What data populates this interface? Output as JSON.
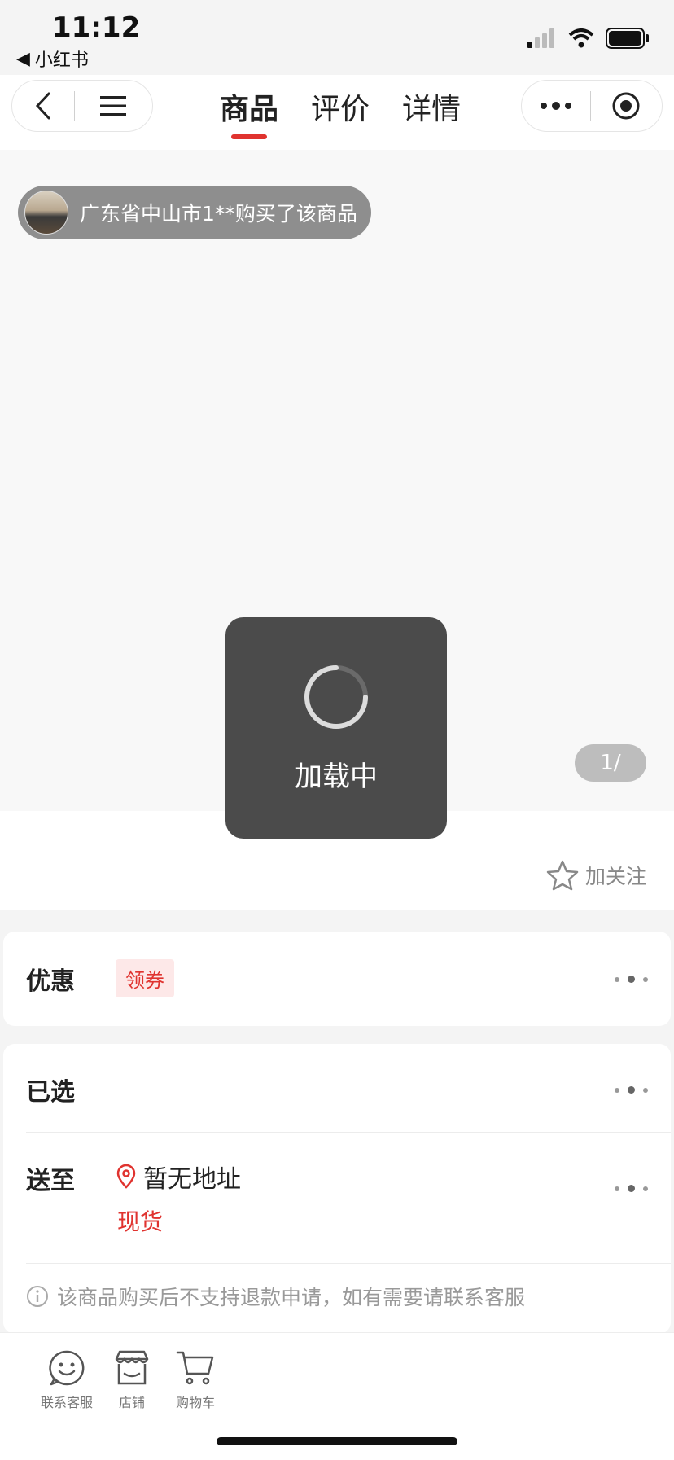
{
  "status_bar": {
    "time": "11:12",
    "back_app": "小红书"
  },
  "nav": {
    "tabs": [
      {
        "label": "商品",
        "active": true
      },
      {
        "label": "评价",
        "active": false
      },
      {
        "label": "详情",
        "active": false
      }
    ]
  },
  "gallery": {
    "buyer_notice": "广东省中山市1**购买了该商品",
    "pager": "1/"
  },
  "loading": {
    "label": "加载中"
  },
  "follow": {
    "label": "加关注"
  },
  "promo": {
    "label": "优惠",
    "coupon": "领券"
  },
  "selection": {
    "selected_label": "已选",
    "ship_label": "送至",
    "address": "暂无地址",
    "stock": "现货",
    "notice": "该商品购买后不支持退款申请，如有需要请联系客服"
  },
  "bottom_bar": {
    "items": [
      {
        "label": "联系客服",
        "icon": "customer-service-icon"
      },
      {
        "label": "店铺",
        "icon": "store-icon"
      },
      {
        "label": "购物车",
        "icon": "cart-icon"
      }
    ]
  },
  "colors": {
    "accent": "#e0332f",
    "toast_bg": "#4b4b4b",
    "pill_bg": "#8e8e8e"
  }
}
